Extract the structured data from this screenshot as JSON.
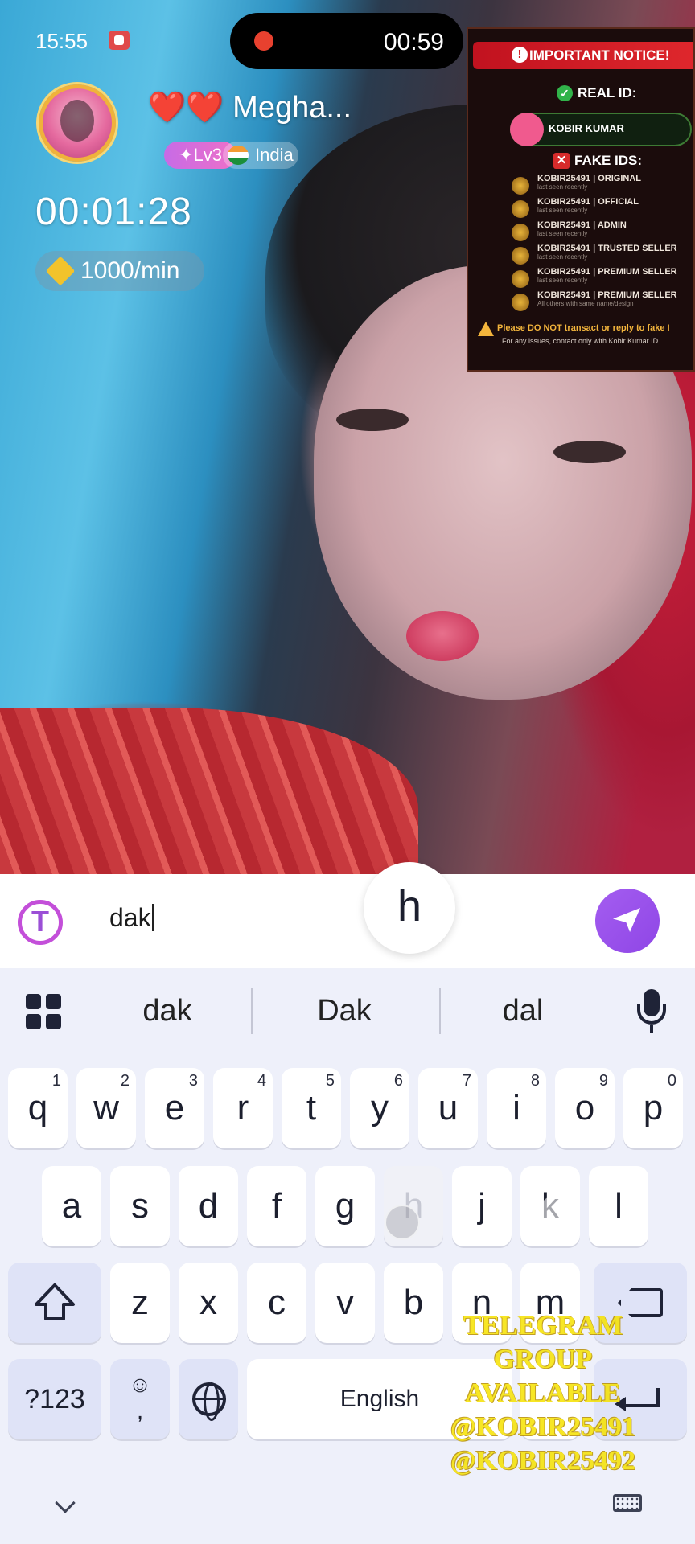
{
  "status_bar": {
    "time": "15:55"
  },
  "recording": {
    "timer": "00:59"
  },
  "host": {
    "name": "❤️❤️ Megha...",
    "level": "✦Lv3",
    "country": "India"
  },
  "call": {
    "duration": "00:01:28",
    "rate": "1000/min"
  },
  "notice": {
    "title": "IMPORTANT NOTICE!",
    "real_label": "REAL ID:",
    "real_name": "KOBIR KUMAR",
    "fake_label": "FAKE IDS:",
    "fake_ids": [
      {
        "name": "KOBIR25491 | ORIGINAL",
        "sub": "last seen recently"
      },
      {
        "name": "KOBIR25491 | OFFICIAL",
        "sub": "last seen recently"
      },
      {
        "name": "KOBIR25491 | ADMIN",
        "sub": "last seen recently"
      },
      {
        "name": "KOBIR25491 | TRUSTED SELLER",
        "sub": "last seen recently"
      },
      {
        "name": "KOBIR25491 | PREMIUM SELLER",
        "sub": "last seen recently"
      },
      {
        "name": "KOBIR25491 | PREMIUM SELLER",
        "sub": "All others with same name/design"
      }
    ],
    "footer": "Please DO NOT transact or reply to fake I",
    "footer2": "For any issues, contact only with Kobir Kumar ID."
  },
  "input": {
    "text": "dak"
  },
  "keyboard": {
    "suggestions": [
      "dak",
      "Dak",
      "dal"
    ],
    "row1": [
      {
        "k": "q",
        "n": "1"
      },
      {
        "k": "w",
        "n": "2"
      },
      {
        "k": "e",
        "n": "3"
      },
      {
        "k": "r",
        "n": "4"
      },
      {
        "k": "t",
        "n": "5"
      },
      {
        "k": "y",
        "n": "6"
      },
      {
        "k": "u",
        "n": "7"
      },
      {
        "k": "i",
        "n": "8"
      },
      {
        "k": "o",
        "n": "9"
      },
      {
        "k": "p",
        "n": "0"
      }
    ],
    "row2": [
      "a",
      "s",
      "d",
      "f",
      "g",
      "h",
      "j",
      "k",
      "l"
    ],
    "row3": [
      "z",
      "x",
      "c",
      "v",
      "b",
      "n",
      "m"
    ],
    "popup": "h",
    "symbols": "?123",
    "emoji": "☺",
    "comma": ",",
    "space": "English"
  },
  "watermark": [
    "TELEGRAM GROUP",
    "AVAILABLE",
    "@KOBIR25491",
    "@KOBIR25492"
  ],
  "colors": {
    "accent": "#9b4fd6",
    "send": "#a45df0",
    "keyboard_bg": "#eef0fa",
    "watermark": "#f6e200"
  }
}
